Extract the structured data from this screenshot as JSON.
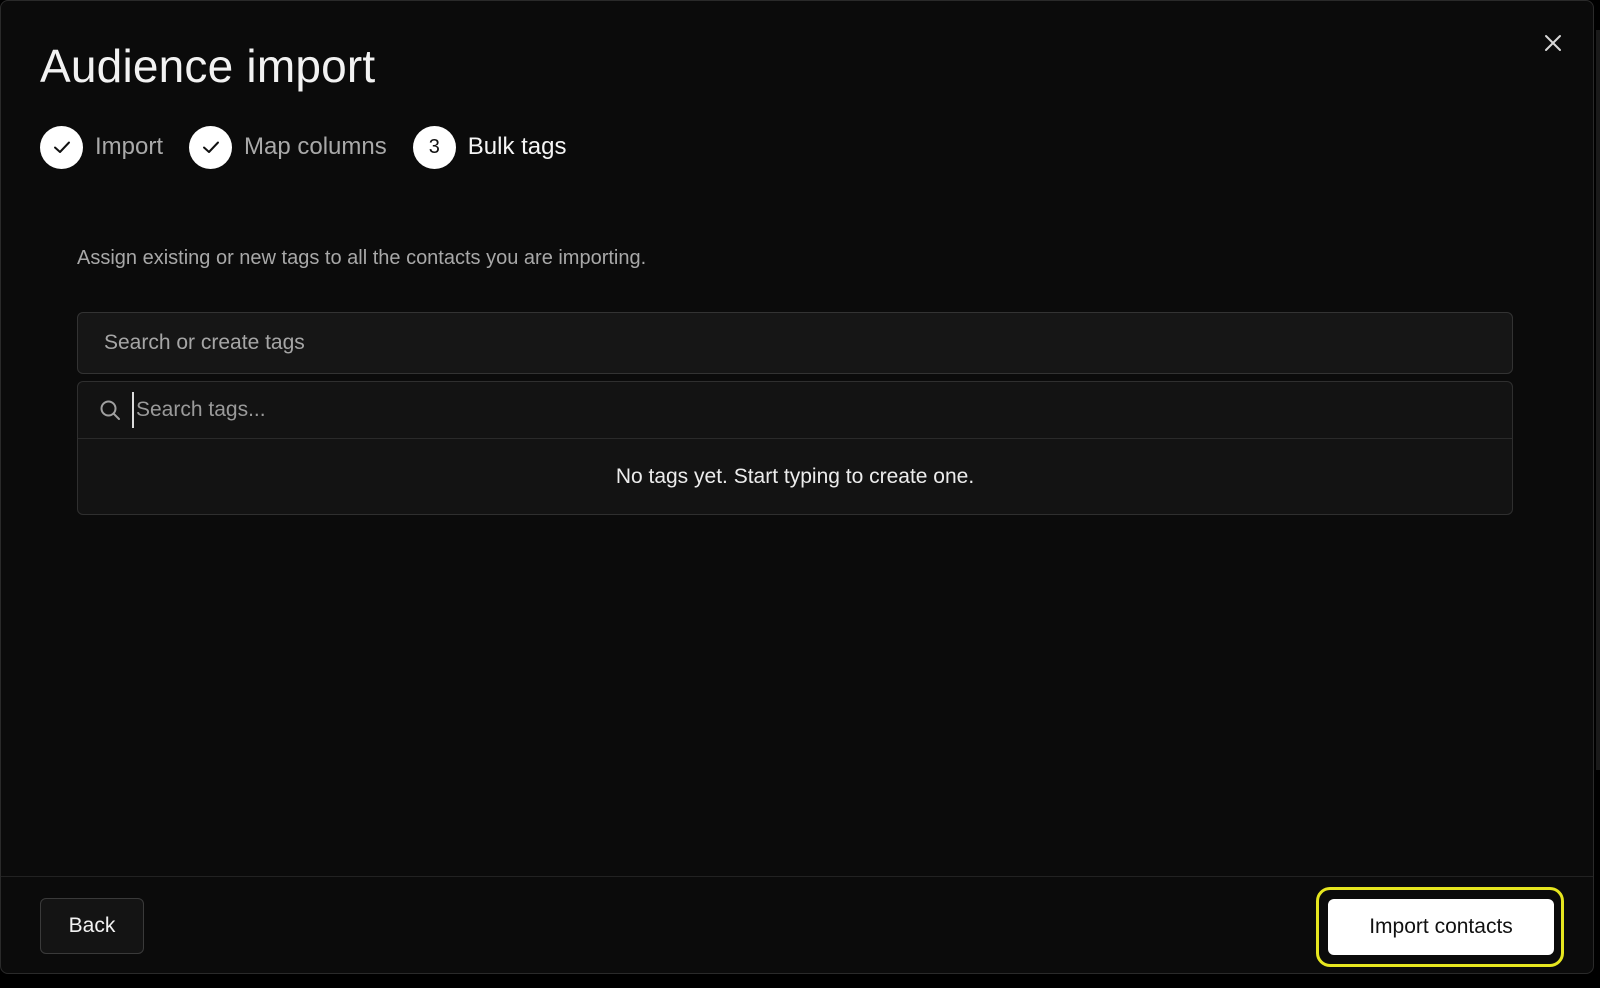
{
  "modal": {
    "title": "Audience import",
    "close_icon": "close-icon"
  },
  "stepper": {
    "steps": [
      {
        "label": "Import",
        "status": "complete",
        "icon": "check-icon"
      },
      {
        "label": "Map columns",
        "status": "complete",
        "icon": "check-icon"
      },
      {
        "label": "Bulk tags",
        "status": "active",
        "number": "3"
      }
    ]
  },
  "bulk_tags": {
    "description": "Assign existing or new tags to all the contacts you are importing.",
    "trigger_placeholder": "Search or create tags",
    "search_placeholder": "Search tags...",
    "search_icon": "search-icon",
    "empty_message": "No tags yet. Start typing to create one."
  },
  "footer": {
    "back_label": "Back",
    "import_label": "Import contacts",
    "highlight_color": "#e6e61f"
  }
}
